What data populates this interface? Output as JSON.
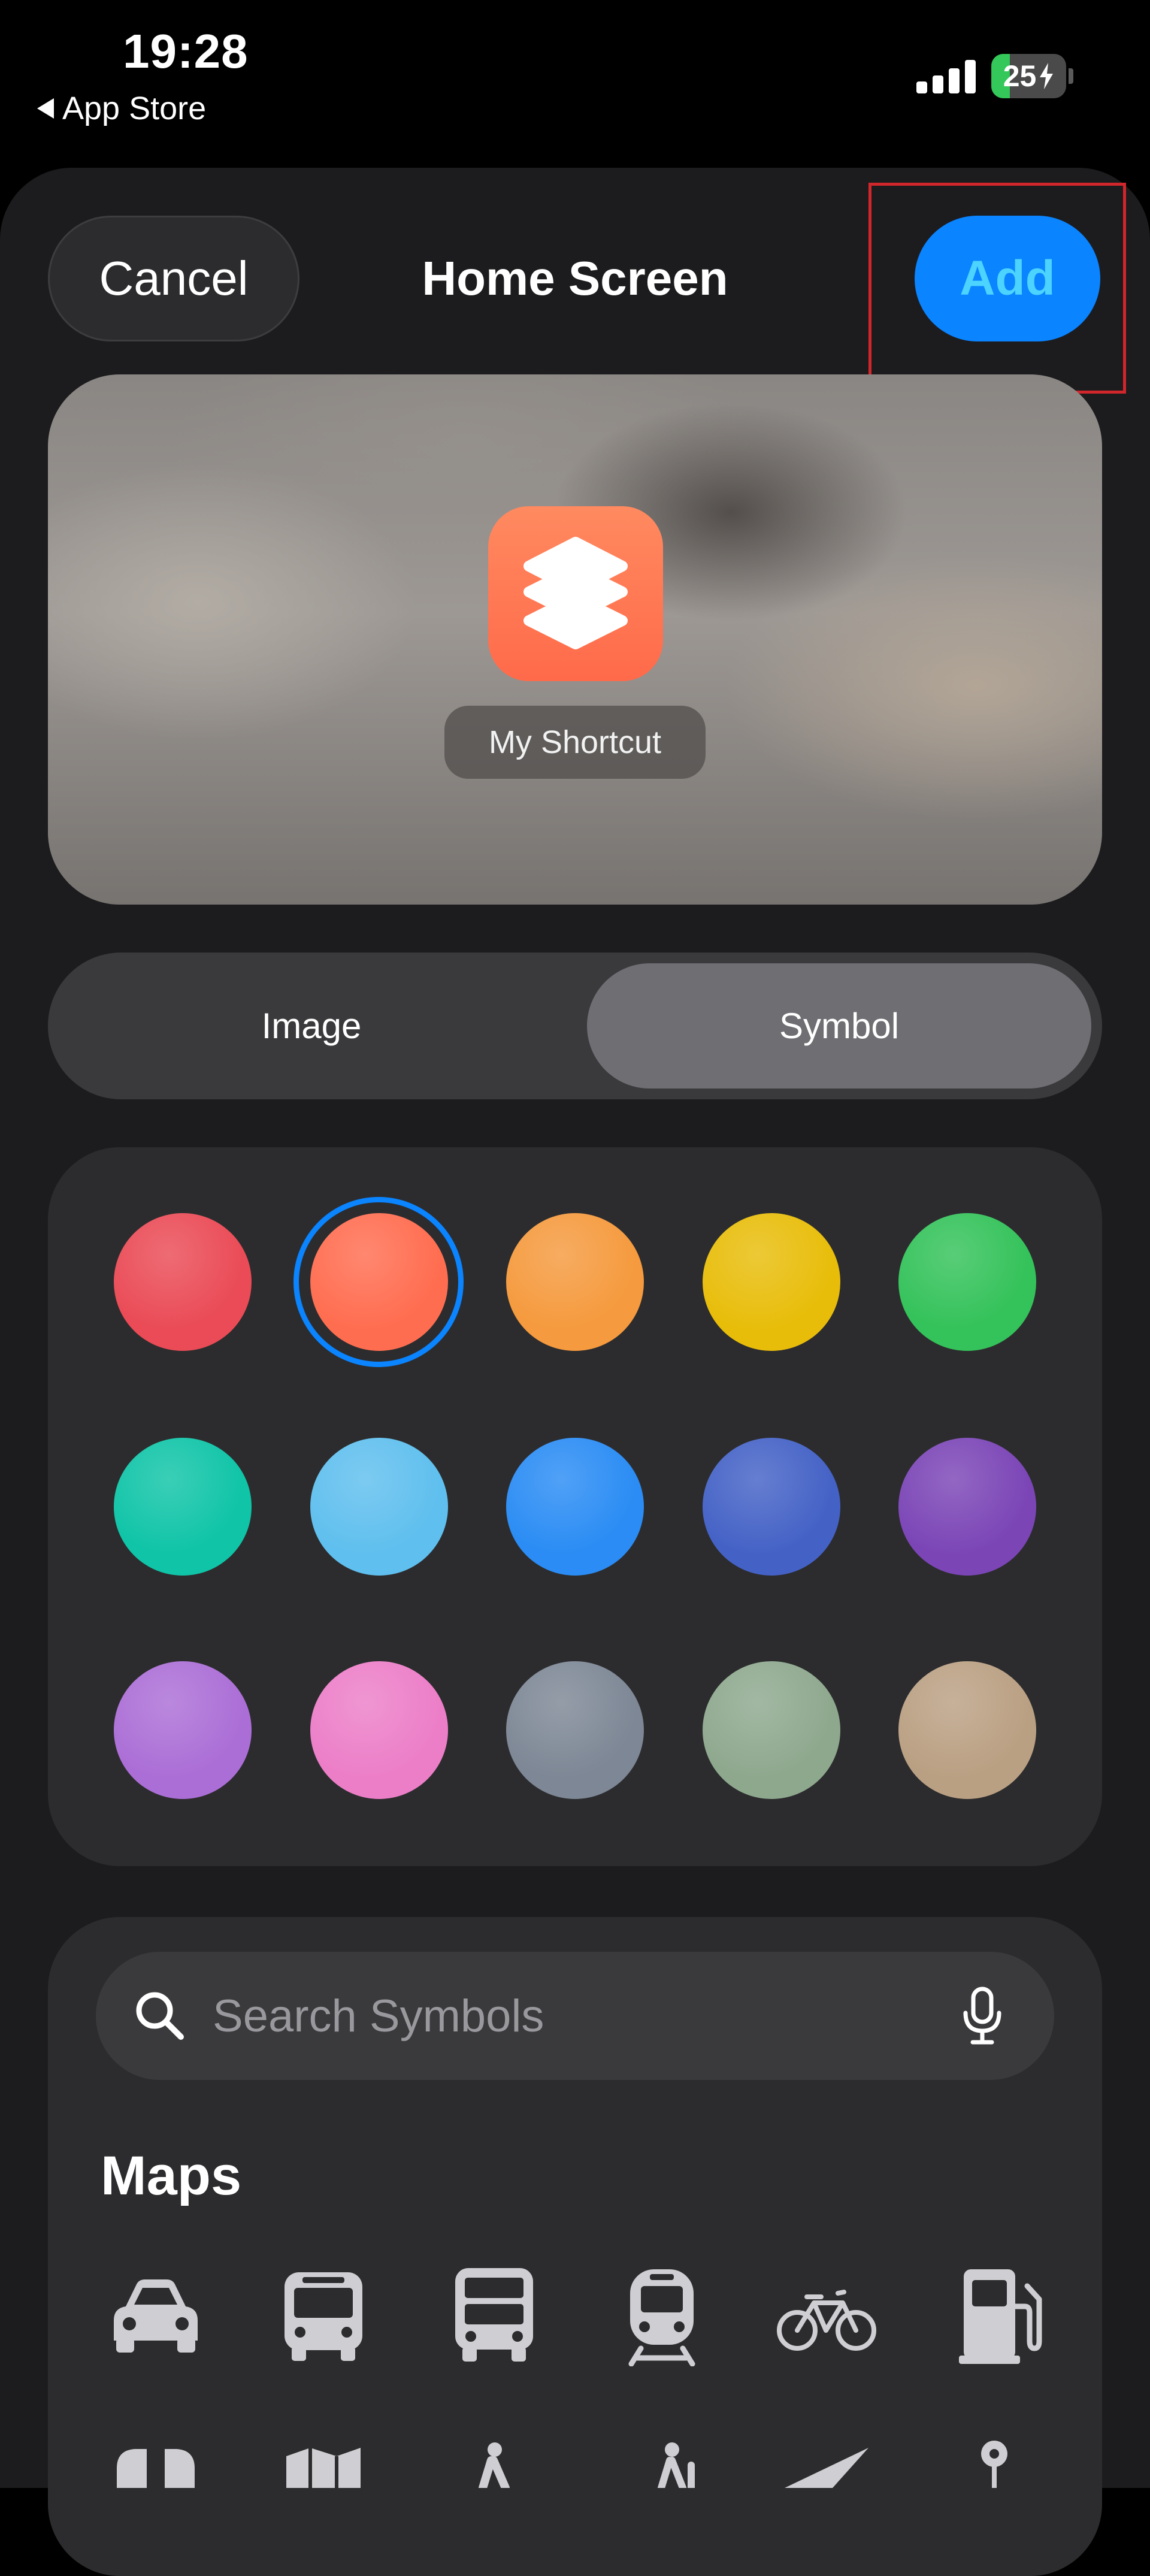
{
  "status_bar": {
    "time": "19:28",
    "back_label": "App Store",
    "battery": "25"
  },
  "header": {
    "cancel_label": "Cancel",
    "title": "Home Screen",
    "add_label": "Add"
  },
  "preview": {
    "shortcut_name": "My Shortcut"
  },
  "segmented": {
    "image_label": "Image",
    "symbol_label": "Symbol",
    "selected": "Symbol"
  },
  "colors": {
    "selected_index": 1,
    "swatches": [
      "#ea4b56",
      "#ff6d50",
      "#f59a3e",
      "#e8bd0a",
      "#34c25a",
      "#0fc4a7",
      "#5fbfee",
      "#2a8cf4",
      "#4462c6",
      "#7b45b6",
      "#ab6ed6",
      "#ec7ec8",
      "#7d8795",
      "#8ea88e",
      "#baa083"
    ]
  },
  "search": {
    "placeholder": "Search Symbols"
  },
  "symbols": {
    "section_title": "Maps",
    "icons": [
      "car-icon",
      "bus-icon",
      "bus-double-decker-icon",
      "tram-icon",
      "bicycle-icon",
      "fuel-pump-icon"
    ]
  },
  "accent": {
    "blue": "#0a84ff",
    "highlight_red": "#d1262b"
  }
}
